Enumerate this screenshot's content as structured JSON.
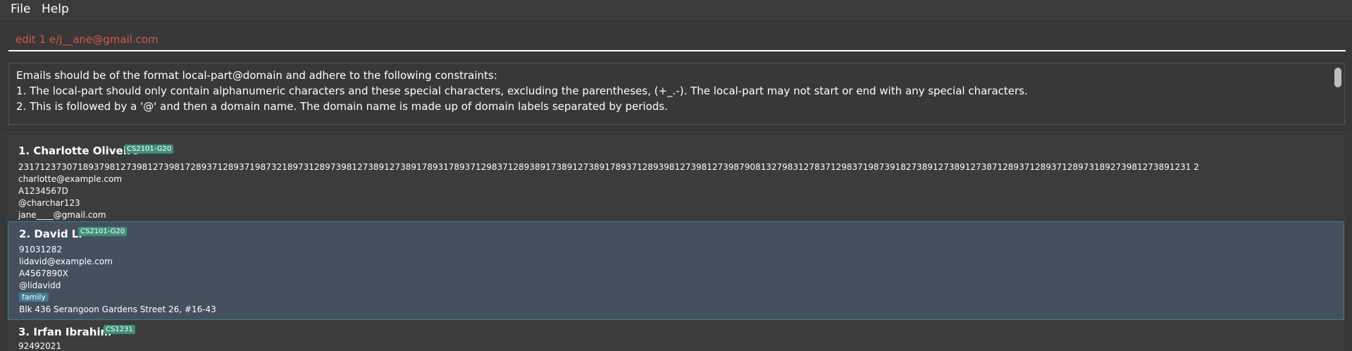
{
  "menu": {
    "file": "File",
    "help": "Help"
  },
  "command": {
    "value": "edit 1 e/j__ane@gmail.com"
  },
  "result": {
    "lines": [
      "Emails should be of the format local-part@domain and adhere to the following constraints:",
      "1. The local-part should only contain alphanumeric characters and these special characters, excluding the parentheses, (+_.-). The local-part may not start or end with any special characters.",
      "2. This is followed by a '@' and then a domain name. The domain name is made up of domain labels separated by periods."
    ]
  },
  "persons": [
    {
      "name": "1. Charlotte Oliveiro",
      "group": "CS2101-G20",
      "phone": "23171237307189379812739812739817289371289371987321897312897398127389127389178931789371298371289389173891273891789371289398127398127398790813279831278371298371987391827389127389127387128937128937128973189273981273891231 2",
      "email": "charlotte@example.com",
      "matric": "A1234567D",
      "telegram": "@charchar123",
      "extra": "jane____@gmail.com"
    },
    {
      "name": "2. David Li",
      "group": "CS2101-G20",
      "phone": "91031282",
      "email": "lidavid@example.com",
      "matric": "A4567890X",
      "telegram": "@lidavidd",
      "tag": "family",
      "address": "Blk 436 Serangoon Gardens Street 26, #16-43"
    },
    {
      "name": "3. Irfan Ibrahim",
      "group": "CS1231",
      "phone": "92492021"
    }
  ]
}
